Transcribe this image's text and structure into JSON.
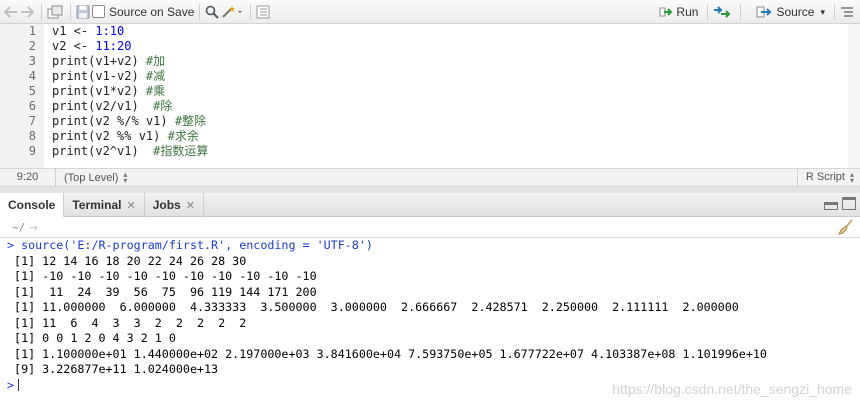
{
  "toolbar": {
    "source_on_save_label": "Source on Save",
    "run_label": "Run",
    "source_label": "Source"
  },
  "editor": {
    "lines": [
      {
        "no": "1",
        "pre": "v1 <- ",
        "num": "1:10",
        "post": "",
        "comment": ""
      },
      {
        "no": "2",
        "pre": "v2 <- ",
        "num": "11:20",
        "post": "",
        "comment": ""
      },
      {
        "no": "3",
        "pre": "print(v1+v2) ",
        "num": "",
        "post": "",
        "comment": "#加"
      },
      {
        "no": "4",
        "pre": "print(v1-v2) ",
        "num": "",
        "post": "",
        "comment": "#减"
      },
      {
        "no": "5",
        "pre": "print(v1*v2) ",
        "num": "",
        "post": "",
        "comment": "#乘"
      },
      {
        "no": "6",
        "pre": "print(v2/v1)  ",
        "num": "",
        "post": "",
        "comment": "#除"
      },
      {
        "no": "7",
        "pre": "print(v2 %/% v1) ",
        "num": "",
        "post": "",
        "comment": "#整除"
      },
      {
        "no": "8",
        "pre": "print(v2 %% v1) ",
        "num": "",
        "post": "",
        "comment": "#求余"
      },
      {
        "no": "9",
        "pre": "print(v2^v1)  ",
        "num": "",
        "post": "",
        "comment": "#指数运算"
      }
    ]
  },
  "status": {
    "position": "9:20",
    "scope": "(Top Level)",
    "filetype": "R Script"
  },
  "console_tabs": [
    {
      "label": "Console",
      "closable": false
    },
    {
      "label": "Terminal",
      "closable": true
    },
    {
      "label": "Jobs",
      "closable": true
    }
  ],
  "console": {
    "working_dir": "~/",
    "command": "> source('E:/R-program/first.R', encoding = 'UTF-8')",
    "output": [
      " [1] 12 14 16 18 20 22 24 26 28 30",
      " [1] -10 -10 -10 -10 -10 -10 -10 -10 -10 -10",
      " [1]  11  24  39  56  75  96 119 144 171 200",
      " [1] 11.000000  6.000000  4.333333  3.500000  3.000000  2.666667  2.428571  2.250000  2.111111  2.000000",
      " [1] 11  6  4  3  3  2  2  2  2  2",
      " [1] 0 0 1 2 0 4 3 2 1 0",
      " [1] 1.100000e+01 1.440000e+02 2.197000e+03 3.841600e+04 7.593750e+05 1.677722e+07 4.103387e+08 1.101996e+10",
      " [9] 3.226877e+11 1.024000e+13"
    ],
    "prompt": ">"
  },
  "watermark": "https://blog.csdn.net/the_sengzi_home",
  "colors": {
    "number": "#0000ff",
    "comment": "#3c763d",
    "console_command": "#1a3ccf"
  }
}
